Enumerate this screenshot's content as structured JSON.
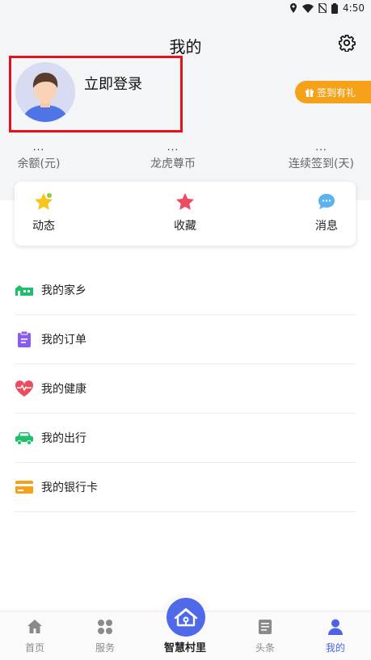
{
  "status_bar": {
    "time": "4:50",
    "icons": [
      "location-icon",
      "wifi-icon",
      "no-sim-icon",
      "battery-icon"
    ]
  },
  "header": {
    "title": "我的",
    "settings_icon": "gear-icon"
  },
  "profile": {
    "login_text": "立即登录",
    "highlight_color": "#e5121d",
    "sign_in_button": "签到有礼",
    "sign_in_color": "#f6a11a"
  },
  "stats": [
    {
      "value": "...",
      "label": "余额(元)"
    },
    {
      "value": "...",
      "label": "龙虎尊币"
    },
    {
      "value": "...",
      "label": "连续签到(天)"
    }
  ],
  "quick_actions": [
    {
      "label": "动态",
      "icon": "star-badge-icon"
    },
    {
      "label": "收藏",
      "icon": "star-icon"
    },
    {
      "label": "消息",
      "icon": "chat-bubble-icon"
    }
  ],
  "menu": [
    {
      "label": "我的家乡",
      "icon": "hometown-icon"
    },
    {
      "label": "我的订单",
      "icon": "clipboard-icon"
    },
    {
      "label": "我的健康",
      "icon": "heart-pulse-icon"
    },
    {
      "label": "我的出行",
      "icon": "car-icon"
    },
    {
      "label": "我的银行卡",
      "icon": "bank-card-icon"
    }
  ],
  "tabbar": {
    "items": [
      {
        "label": "首页",
        "icon": "home-icon"
      },
      {
        "label": "服务",
        "icon": "grid-icon"
      },
      {
        "label": "智慧村里",
        "icon": "smart-village-icon"
      },
      {
        "label": "头条",
        "icon": "news-icon"
      },
      {
        "label": "我的",
        "icon": "user-icon"
      }
    ],
    "active_index": 4,
    "active_color": "#4b63e8"
  }
}
